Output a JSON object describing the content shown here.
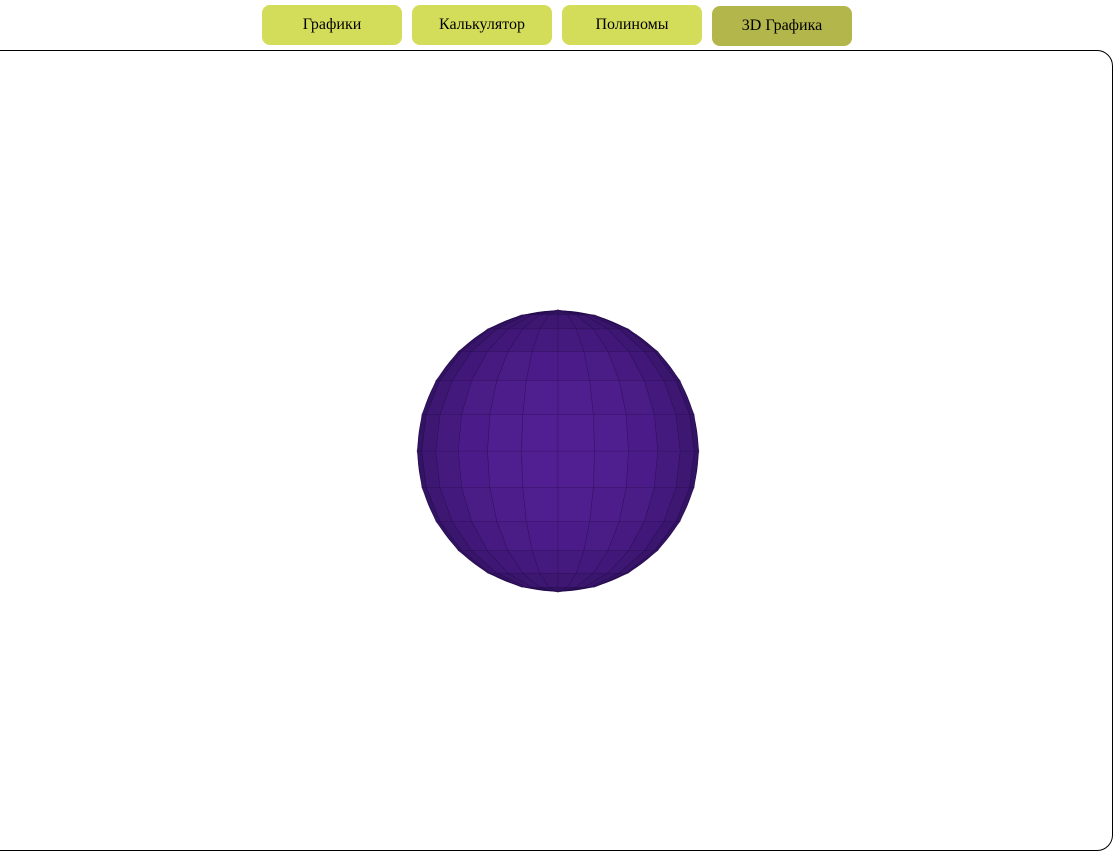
{
  "tabs": [
    {
      "label": "Графики",
      "active": false
    },
    {
      "label": "Калькулятор",
      "active": false
    },
    {
      "label": "Полиномы",
      "active": false
    },
    {
      "label": "3D Графика",
      "active": true
    }
  ],
  "colors": {
    "tab_inactive": "#d4dd5a",
    "tab_active": "#b3b64a",
    "sphere_light": "#521f93",
    "sphere_dark": "#2c1058"
  },
  "scene": {
    "object": "sphere",
    "object_icon": "faceted-sphere"
  }
}
